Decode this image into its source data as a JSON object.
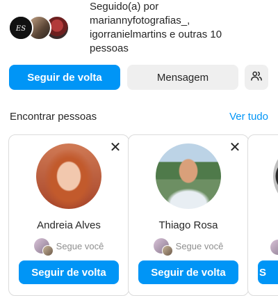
{
  "followed_by": {
    "line1": "Seguido(a) por",
    "line2": "mariannyfotografias_,",
    "line3": "igorranielmartins e outras 10",
    "line4": "pessoas",
    "avatar_logo_text": "ES"
  },
  "actions": {
    "follow_back": "Seguir de volta",
    "message": "Mensagem"
  },
  "suggestions": {
    "title": "Encontrar pessoas",
    "see_all": "Ver tudo",
    "cards": [
      {
        "name": "Andreia Alves",
        "mutual": "Segue você",
        "button": "Seguir de volta"
      },
      {
        "name": "Thiago Rosa",
        "mutual": "Segue você",
        "button": "Seguir de volta"
      },
      {
        "button": "S"
      }
    ]
  },
  "colors": {
    "primary": "#0095f6",
    "secondary_button": "#efefef",
    "text": "#262626",
    "muted": "#8e8e8e"
  },
  "icons": {
    "close": "close-icon",
    "people": "discover-people-icon"
  }
}
